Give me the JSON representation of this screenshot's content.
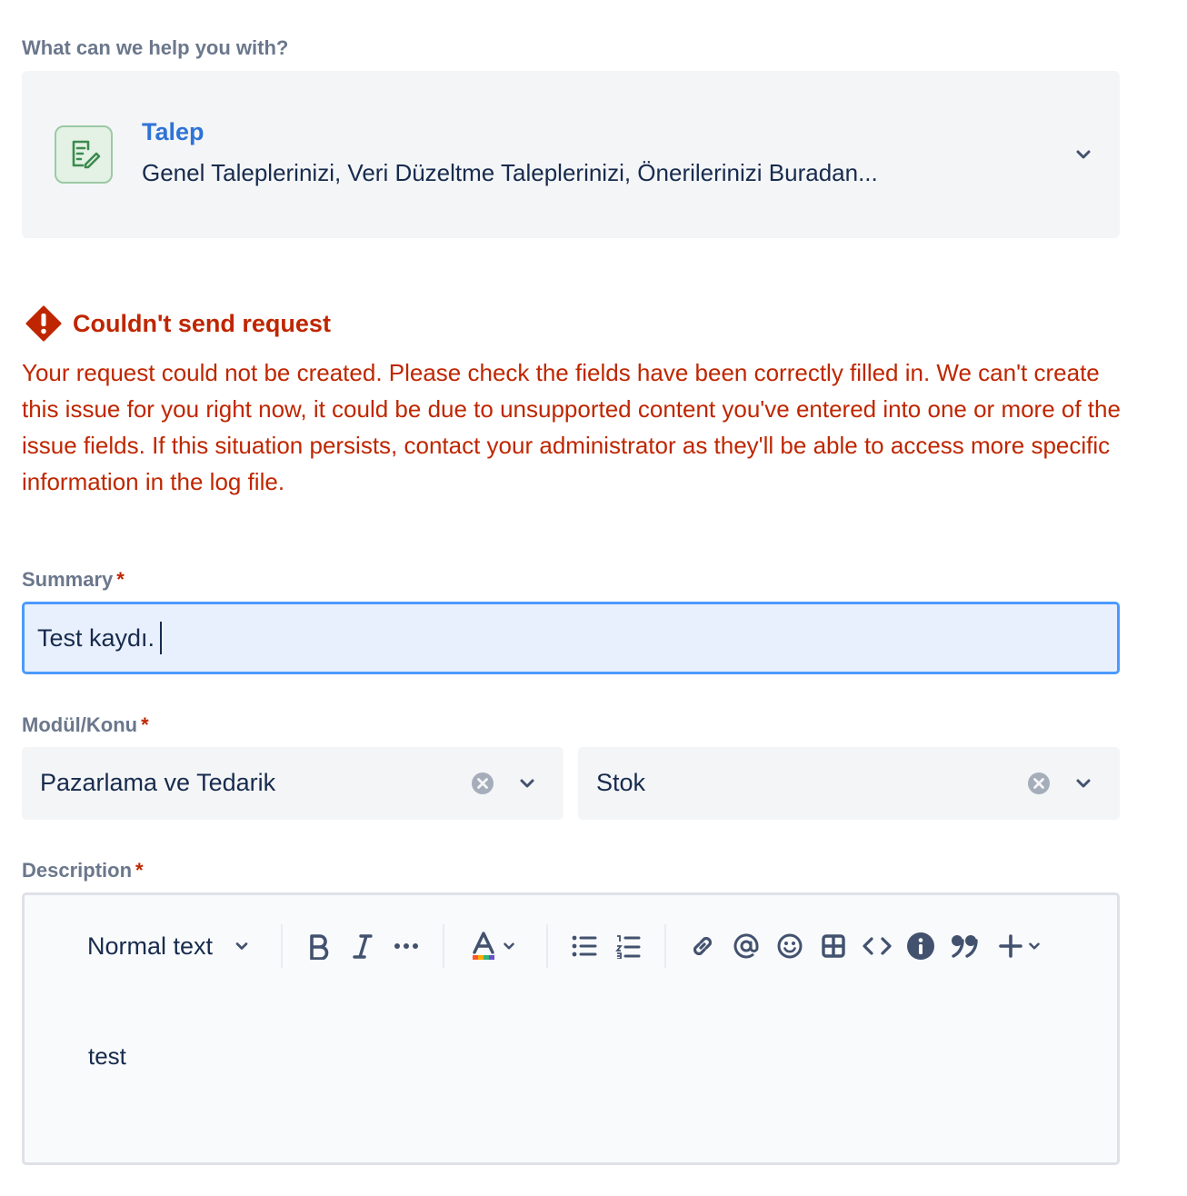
{
  "request_type": {
    "question": "What can we help you with?",
    "title": "Talep",
    "description": "Genel Taleplerinizi, Veri Düzeltme Taleplerinizi, Önerilerinizi Buradan..."
  },
  "error": {
    "title": "Couldn't send request",
    "message": "Your request could not be created. Please check the fields have been correctly filled in. We can't create this issue for you right now, it could be due to unsupported content you've entered into one or more of the issue fields. If this situation persists, contact your administrator as they'll be able to access more specific information in the log file."
  },
  "summary": {
    "label": "Summary",
    "required_mark": "*",
    "value": "Test kaydı."
  },
  "modul": {
    "label": "Modül/Konu",
    "required_mark": "*",
    "first_value": "Pazarlama ve Tedarik",
    "second_value": "Stok"
  },
  "description": {
    "label": "Description",
    "required_mark": "*",
    "text_style": "Normal text",
    "content": "test"
  },
  "colors": {
    "error": "#bf2600",
    "link": "#2e73d6",
    "focus_border": "#4c9aff",
    "field_bg": "#f4f5f7"
  },
  "icons": {
    "request_type": "edit-document-icon",
    "error": "error-diamond-icon",
    "toolbar": [
      "bold-icon",
      "italic-icon",
      "more-icon",
      "text-color-icon",
      "bullet-list-icon",
      "numbered-list-icon",
      "link-icon",
      "mention-icon",
      "emoji-icon",
      "table-icon",
      "code-icon",
      "info-icon",
      "quote-icon",
      "insert-icon"
    ]
  }
}
